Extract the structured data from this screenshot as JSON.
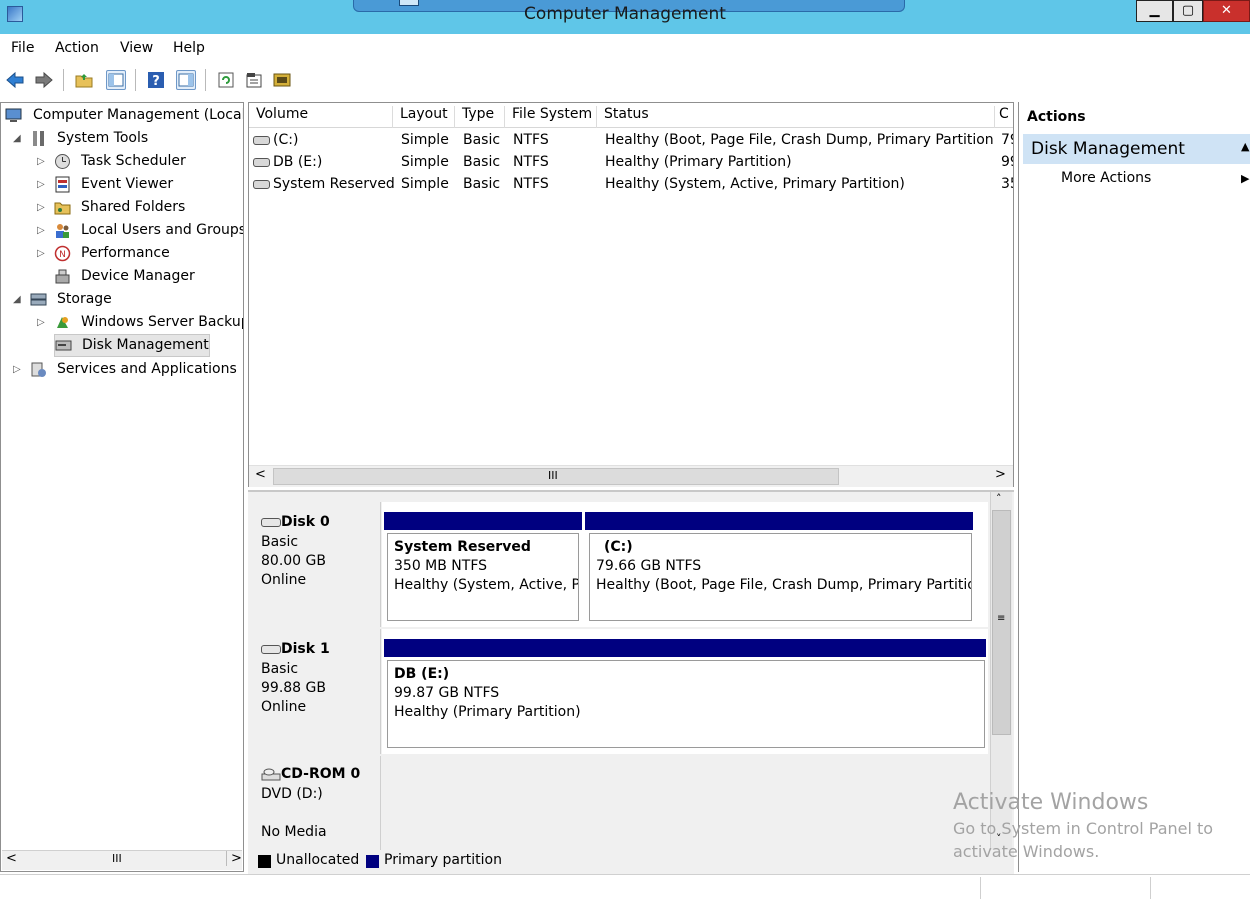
{
  "window": {
    "title": "Computer Management"
  },
  "menu": [
    "File",
    "Action",
    "View",
    "Help"
  ],
  "tree": {
    "items": [
      {
        "label": "Computer Management (Local"
      },
      {
        "label": "System Tools"
      },
      {
        "label": "Task Scheduler"
      },
      {
        "label": "Event Viewer"
      },
      {
        "label": "Shared Folders"
      },
      {
        "label": "Local Users and Groups"
      },
      {
        "label": "Performance"
      },
      {
        "label": "Device Manager"
      },
      {
        "label": "Storage"
      },
      {
        "label": "Windows Server Backup"
      },
      {
        "label": "Disk Management"
      },
      {
        "label": "Services and Applications"
      }
    ]
  },
  "volume_list": {
    "columns": [
      "Volume",
      "Layout",
      "Type",
      "File System",
      "Status",
      "C"
    ],
    "rows": [
      {
        "volume": "(C:)",
        "layout": "Simple",
        "type": "Basic",
        "fs": "NTFS",
        "status": "Healthy (Boot, Page File, Crash Dump, Primary Partition)",
        "cap": "79"
      },
      {
        "volume": "DB (E:)",
        "layout": "Simple",
        "type": "Basic",
        "fs": "NTFS",
        "status": "Healthy (Primary Partition)",
        "cap": "99"
      },
      {
        "volume": "System Reserved",
        "layout": "Simple",
        "type": "Basic",
        "fs": "NTFS",
        "status": "Healthy (System, Active, Primary Partition)",
        "cap": "35"
      }
    ],
    "scroll_grip": "III"
  },
  "disks": [
    {
      "name": "Disk 0",
      "type": "Basic",
      "size": "80.00 GB",
      "state": "Online",
      "partitions": [
        {
          "title": "System Reserved",
          "size": "350 MB NTFS",
          "status": "Healthy (System, Active, Pr"
        },
        {
          "title": "(C:)",
          "size": "79.66 GB NTFS",
          "status": "Healthy (Boot, Page File, Crash Dump, Primary Partitio"
        }
      ]
    },
    {
      "name": "Disk 1",
      "type": "Basic",
      "size": "99.88 GB",
      "state": "Online",
      "partitions": [
        {
          "title": "DB  (E:)",
          "size": "99.87 GB NTFS",
          "status": "Healthy (Primary Partition)"
        }
      ]
    },
    {
      "name": "CD-ROM 0",
      "type": "DVD (D:)",
      "state": "No Media"
    }
  ],
  "legend": [
    {
      "label": "Unallocated",
      "color": "#000000"
    },
    {
      "label": "Primary partition",
      "color": "#000080"
    }
  ],
  "actions": {
    "title": "Actions",
    "section": "Disk Management",
    "items": [
      "More Actions"
    ]
  },
  "watermark": {
    "title": "Activate Windows",
    "line1": "Go to System in Control Panel to",
    "line2": "activate Windows."
  },
  "colors": {
    "titlebar": "#5fc6e8",
    "partition_bar": "#000080",
    "section_highlight": "#cfe3f5"
  }
}
